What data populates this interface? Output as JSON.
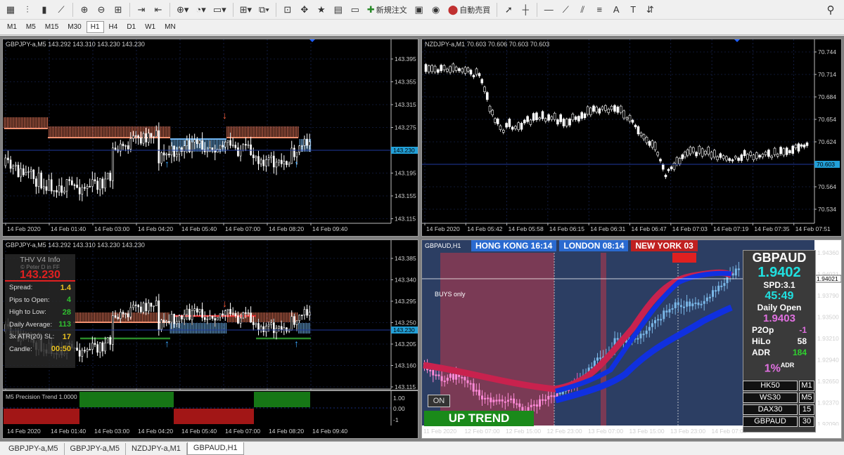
{
  "toolbar": {
    "buttons": [
      {
        "name": "new-chart-icon",
        "glyph": "▦"
      },
      {
        "name": "bar-chart-icon",
        "glyph": "⫶"
      },
      {
        "name": "candle-chart-icon",
        "glyph": "▮"
      },
      {
        "name": "line-chart-icon",
        "glyph": "⟋"
      },
      {
        "name": "zoom-in-icon",
        "glyph": "⊕"
      },
      {
        "name": "zoom-out-icon",
        "glyph": "⊖"
      },
      {
        "name": "tile-windows-icon",
        "glyph": "⊞"
      },
      {
        "name": "autoscroll-icon",
        "glyph": "⇥"
      },
      {
        "name": "chart-shift-icon",
        "glyph": "⇤"
      },
      {
        "name": "indicators-icon",
        "glyph": "⊕▾"
      },
      {
        "name": "periods-icon",
        "glyph": "◔▾"
      },
      {
        "name": "templates-icon",
        "glyph": "▭▾"
      },
      {
        "name": "profiles-icon",
        "glyph": "⊞▾"
      },
      {
        "name": "windows-icon",
        "glyph": "⧉▾"
      },
      {
        "name": "navigator-icon",
        "glyph": "⊡"
      },
      {
        "name": "crosshair-move-icon",
        "glyph": "✥"
      },
      {
        "name": "favorites-icon",
        "glyph": "★"
      },
      {
        "name": "data-window-icon",
        "glyph": "▤"
      },
      {
        "name": "terminal-icon",
        "glyph": "▭"
      }
    ],
    "new_order_label": "新規注文",
    "auto_trading_label": "自動売買",
    "tools": [
      {
        "name": "cursor-icon",
        "glyph": "➚"
      },
      {
        "name": "crosshair-icon",
        "glyph": "┼"
      },
      {
        "name": "hline-icon",
        "glyph": "—"
      },
      {
        "name": "trendline-icon",
        "glyph": "⟋"
      },
      {
        "name": "equidistant-channel-icon",
        "glyph": "⫽"
      },
      {
        "name": "fibonacci-icon",
        "glyph": "≡"
      },
      {
        "name": "text-icon",
        "glyph": "A"
      },
      {
        "name": "label-icon",
        "glyph": "T"
      },
      {
        "name": "arrows-icon",
        "glyph": "⇵"
      }
    ],
    "search_glyph": "⚲"
  },
  "timeframes": [
    "M1",
    "M5",
    "M15",
    "M30",
    "H1",
    "H4",
    "D1",
    "W1",
    "MN"
  ],
  "active_timeframe": "H1",
  "charts": {
    "tl": {
      "header": "GBPJPY-a,M5  143.292 143.310 143.230 143.230",
      "price_labels": [
        "143.395",
        "143.355",
        "143.315",
        "143.275",
        "143.235",
        "143.195",
        "143.155",
        "143.115"
      ],
      "current_price": "143.230",
      "time_labels": [
        "14 Feb 2020",
        "14 Feb 01:40",
        "14 Feb 03:00",
        "14 Feb 04:20",
        "14 Feb 05:40",
        "14 Feb 07:00",
        "14 Feb 08:20",
        "14 Feb 09:40"
      ]
    },
    "tr": {
      "header": "NZDJPY-a,M1  70.603 70.606 70.603 70.603",
      "price_labels": [
        "70.744",
        "70.714",
        "70.684",
        "70.654",
        "70.624",
        "70.594",
        "70.564",
        "70.534"
      ],
      "current_price": "70.603",
      "time_labels": [
        "14 Feb 2020",
        "14 Feb 05:42",
        "14 Feb 05:58",
        "14 Feb 06:15",
        "14 Feb 06:31",
        "14 Feb 06:47",
        "14 Feb 07:03",
        "14 Feb 07:19",
        "14 Feb 07:35",
        "14 Feb 07:51"
      ]
    },
    "bl": {
      "header": "GBPJPY-a,M5  143.292 143.310 143.230 143.230",
      "price_labels": [
        "143.385",
        "143.340",
        "143.295",
        "143.250",
        "143.205",
        "143.160",
        "143.115"
      ],
      "current_price": "143.230",
      "time_labels": [
        "14 Feb 2020",
        "14 Feb 01:40",
        "14 Feb 03:00",
        "14 Feb 04:20",
        "14 Feb 05:40",
        "14 Feb 07:00",
        "14 Feb 08:20",
        "14 Feb 09:40"
      ],
      "sub_header": "M5 Precision Trend 1.0000",
      "sub_levels": [
        "1.00",
        "0.00",
        "-1"
      ],
      "info": {
        "title": "THV  V4  Info",
        "credit": "© Peter D in FF",
        "price": "143.230",
        "rows": [
          {
            "k": "Spread:",
            "v": "1.4",
            "c": "#e8c020"
          },
          {
            "k": "Pips to Open:",
            "v": "4",
            "c": "#30c030"
          },
          {
            "k": "High to Low:",
            "v": "28",
            "c": "#30c030"
          },
          {
            "k": "Daily Average:",
            "v": "113",
            "c": "#30c030"
          },
          {
            "k": "3x ATR(20) SL:",
            "v": "17",
            "c": "#e8c020"
          },
          {
            "k": "Candle:",
            "v": "00:50",
            "c": "#e8c020"
          }
        ]
      }
    },
    "br": {
      "header": "GBPAUD,H1",
      "sessions": [
        {
          "label": "HONG KONG  16:14",
          "bg": "#2a6ad0"
        },
        {
          "label": "LONDON   08:14",
          "bg": "#2a6ad0"
        },
        {
          "label": "NEW YORK  03",
          "bg": "#c02020"
        }
      ],
      "buys_only": "BUYS only",
      "on_label": "ON",
      "trend_label": "UP TREND",
      "price_labels": [
        "1.94360",
        "1.94021",
        "1.93790",
        "1.93500",
        "1.93210",
        "1.92940",
        "1.92650",
        "1.92370",
        "1.92090"
      ],
      "current_price": "1.94021",
      "time_labels": [
        "11 Feb 2020",
        "12 Feb 07:00",
        "12 Feb 15:00",
        "12 Feb 23:00",
        "13 Feb 07:00",
        "13 Feb 15:00",
        "13 Feb 23:00",
        "14 Feb 07:00"
      ],
      "panel": {
        "symbol": "GBPAUD",
        "bid": "1.9402",
        "spd": "SPD:3.1",
        "timer": "45:49",
        "daily_open_label": "Daily Open",
        "daily_open": "1.9403",
        "p2o_label": "P2Op",
        "p2o": "-1",
        "hilo_label": "HiLo",
        "hilo": "58",
        "adr_label": "ADR",
        "adr": "184",
        "pct": "1%",
        "pct_sup": "ADR"
      },
      "symbols": [
        {
          "name": "HK50",
          "tf": "M1"
        },
        {
          "name": "WS30",
          "tf": "M5"
        },
        {
          "name": "DAX30",
          "tf": "15"
        },
        {
          "name": "GBPAUD",
          "tf": "30"
        }
      ]
    }
  },
  "tabs": [
    "GBPJPY-a,M5",
    "GBPJPY-a,M5",
    "NZDJPY-a,M1",
    "GBPAUD,H1"
  ],
  "active_tab": 3
}
